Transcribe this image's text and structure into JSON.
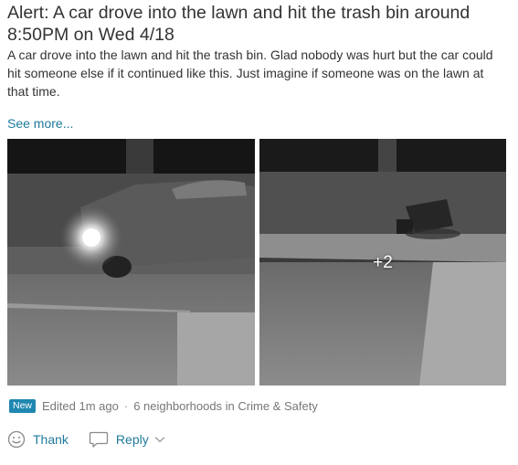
{
  "post": {
    "title": "Alert: A car drove into the lawn and hit the trash bin around 8:50PM on Wed 4/18",
    "body": "A car drove into the lawn and hit the trash bin. Glad nobody was hurt but the car could hit someone else if it continued like this. Just imagine if someone was on the lawn at that time.",
    "see_more": "See more...",
    "photos": {
      "more_count": "+2"
    },
    "meta": {
      "badge": "New",
      "edited": "Edited 1m ago",
      "separator": "·",
      "scope": "6 neighborhoods in Crime & Safety"
    },
    "actions": {
      "thank_label": "Thank",
      "reply_label": "Reply"
    }
  },
  "colors": {
    "link": "#1f7a9c",
    "badge": "#1f87b0",
    "meta_text": "#777777"
  },
  "icons": {
    "thank": "smiley-icon",
    "reply": "speech-bubble-icon",
    "reply_menu": "chevron-down-icon"
  }
}
